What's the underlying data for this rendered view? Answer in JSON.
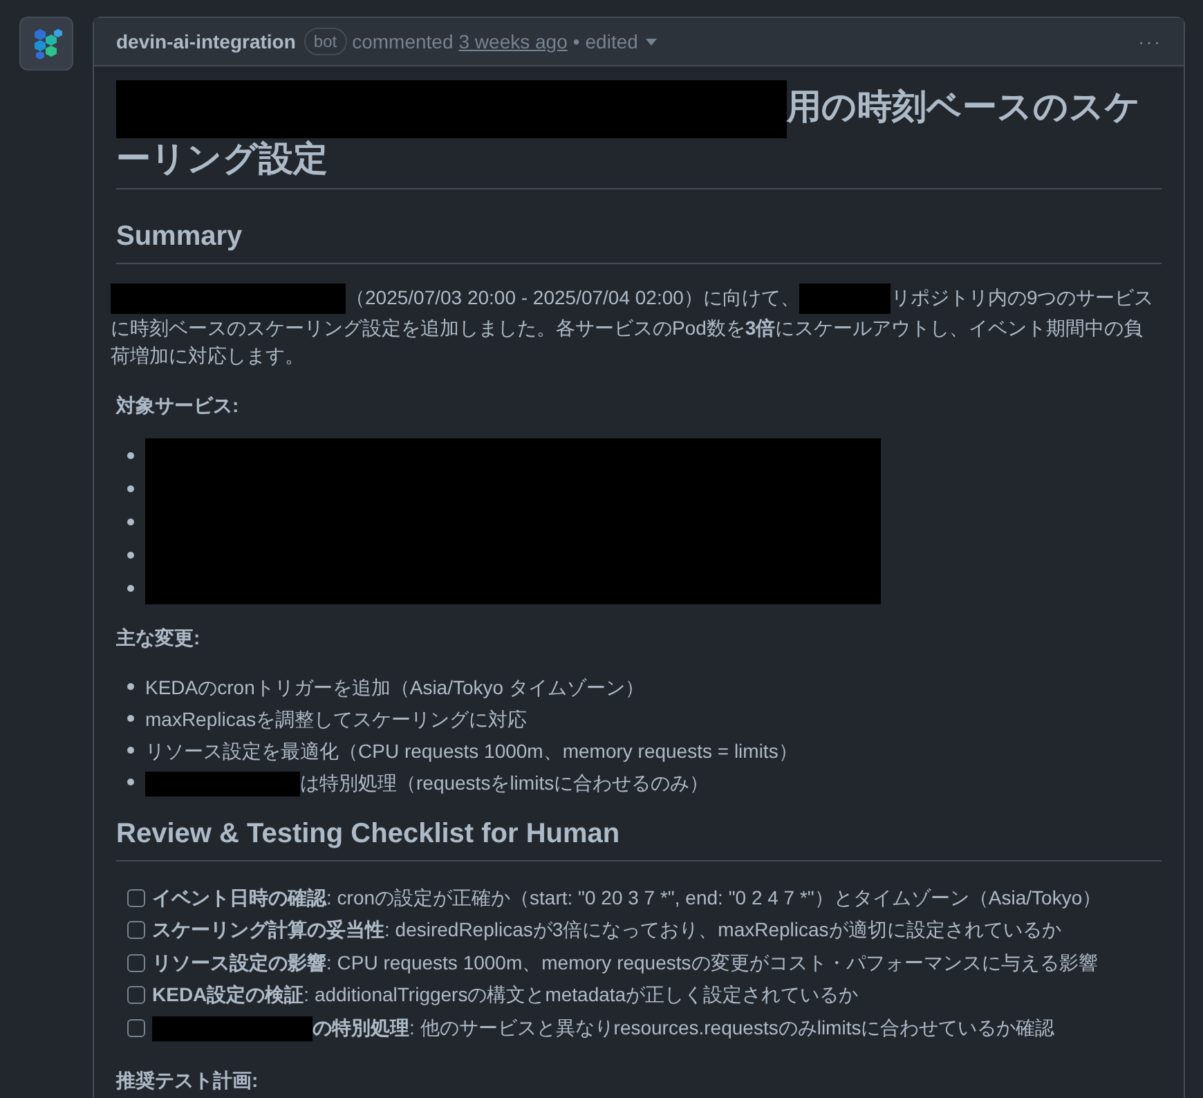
{
  "comment": {
    "author": "devin-ai-integration",
    "badge": "bot",
    "action": "commented",
    "time": "3 weeks ago",
    "separator": "•",
    "edited": "edited",
    "menu": "···"
  },
  "title": [
    {
      "kind": "redacted"
    },
    {
      "kind": "text",
      "text": "用の時刻ベースのスケーリング設定"
    }
  ],
  "sections": [
    {
      "kind": "h2",
      "text": "Summary"
    },
    {
      "kind": "paragraph",
      "segments": [
        {
          "kind": "redacted"
        },
        {
          "kind": "text",
          "text": "（2025/07/03 20:00 - 2025/07/04 02:00）に向けて、"
        },
        {
          "kind": "redacted"
        },
        {
          "kind": "text",
          "text": "リポジトリ内の9つのサービスに時刻ベースのスケーリング設定を追加しました。各サービスのPod数を**3倍**にスケールアウトし、イベント期間中の負荷増加に対応します。"
        }
      ]
    },
    {
      "kind": "label",
      "text": "対象サービス:"
    },
    {
      "kind": "bullets",
      "items": [
        [
          {
            "kind": "redacted"
          }
        ],
        [
          {
            "kind": "redacted"
          }
        ],
        [
          {
            "kind": "redacted"
          }
        ],
        [
          {
            "kind": "redacted"
          }
        ],
        [
          {
            "kind": "redacted"
          }
        ]
      ]
    },
    {
      "kind": "label",
      "text": "主な変更:"
    },
    {
      "kind": "bullets",
      "items": [
        [
          {
            "kind": "text",
            "text": "KEDAのcronトリガーを追加（Asia/Tokyo タイムゾーン）"
          }
        ],
        [
          {
            "kind": "text",
            "text": "maxReplicasを調整してスケーリングに対応"
          }
        ],
        [
          {
            "kind": "text",
            "text": "リソース設定を最適化（CPU requests 1000m、memory requests = limits）"
          }
        ],
        [
          {
            "kind": "redacted"
          },
          {
            "kind": "text",
            "text": "は特別処理（requestsをlimitsに合わせるのみ）"
          }
        ]
      ]
    },
    {
      "kind": "h2",
      "text": "Review & Testing Checklist for Human"
    },
    {
      "kind": "checklist",
      "items": [
        {
          "checked": false,
          "segments": [
            {
              "kind": "text",
              "text": "**イベント日時の確認**: cronの設定が正確か（start: \"0 20 3 7 *\", end: \"0 2 4 7 *\"）とタイムゾーン（Asia/Tokyo）"
            }
          ]
        },
        {
          "checked": false,
          "segments": [
            {
              "kind": "text",
              "text": "**スケーリング計算の妥当性**: desiredReplicasが3倍になっており、maxReplicasが適切に設定されているか"
            }
          ]
        },
        {
          "checked": false,
          "segments": [
            {
              "kind": "text",
              "text": "**リソース設定の影響**: CPU requests 1000m、memory requestsの変更がコスト・パフォーマンスに与える影響"
            }
          ]
        },
        {
          "checked": false,
          "segments": [
            {
              "kind": "text",
              "text": "**KEDA設定の検証**: additionalTriggersの構文とmetadataが正しく設定されているか"
            }
          ]
        },
        {
          "checked": false,
          "segments": [
            {
              "kind": "redacted"
            },
            {
              "kind": "text",
              "text": "**の特別処理**: 他のサービスと異なりresources.requestsのみlimitsに合わせているか確認"
            }
          ]
        }
      ]
    },
    {
      "kind": "label",
      "text": "推奨テスト計画:"
    }
  ]
}
